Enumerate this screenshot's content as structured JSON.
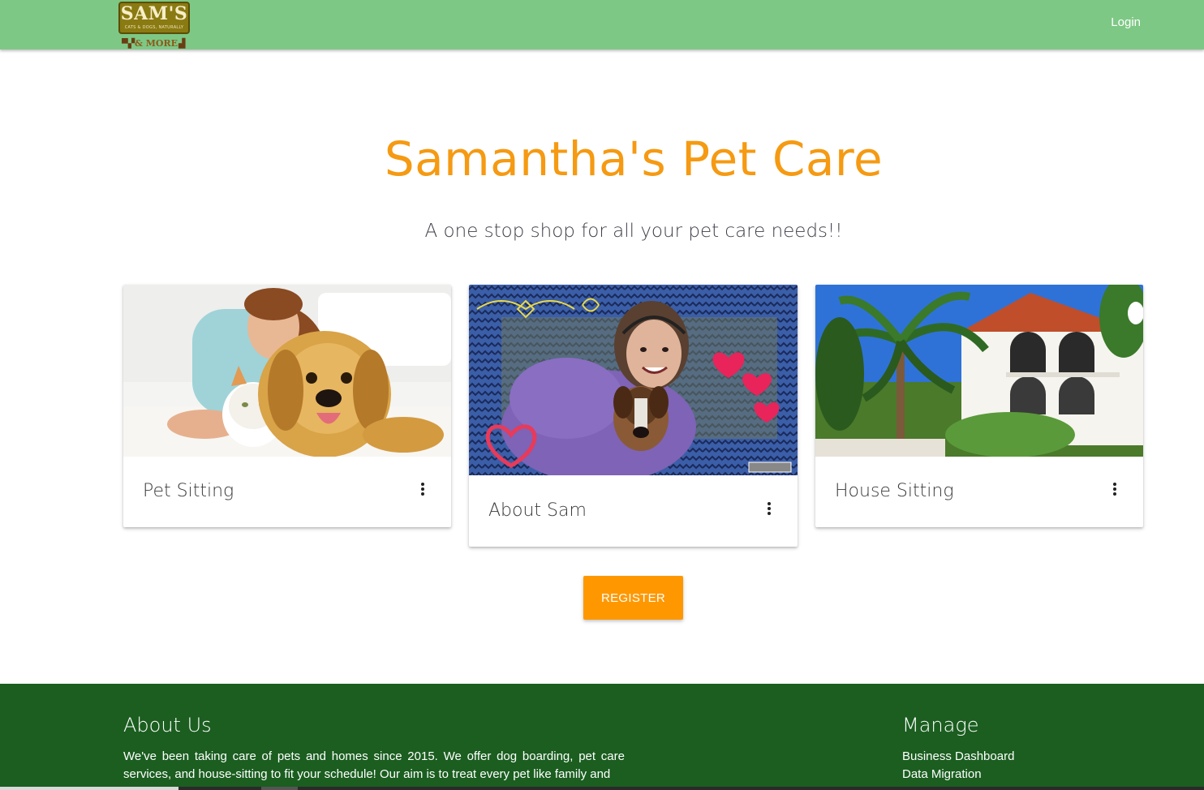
{
  "nav": {
    "logo_title": "SAM'S",
    "logo_tagline": "CATS & DOGS, NATURALLY",
    "logo_more": "& MORE",
    "login_label": "Login"
  },
  "hero": {
    "title": "Samantha's Pet Care",
    "subtitle": "A one stop shop for all your pet care needs!!"
  },
  "cards": [
    {
      "title": "Pet Sitting",
      "menu_icon": "more-vert-icon"
    },
    {
      "title": "About Sam",
      "menu_icon": "more-vert-icon"
    },
    {
      "title": "House Sitting",
      "menu_icon": "more-vert-icon"
    }
  ],
  "register_label": "REGISTER",
  "footer": {
    "about_heading": "About Us",
    "about_text": "We've been taking care of pets and homes since 2015. We offer dog boarding, pet care services, and house-sitting to fit your schedule! Our aim is to treat every pet like family and",
    "manage_heading": "Manage",
    "links": [
      "Business Dashboard",
      "Data Migration"
    ]
  },
  "colors": {
    "navbar": "#7ec885",
    "accent": "#ff9800",
    "title": "#f59a12",
    "footer": "#1b5e20"
  }
}
